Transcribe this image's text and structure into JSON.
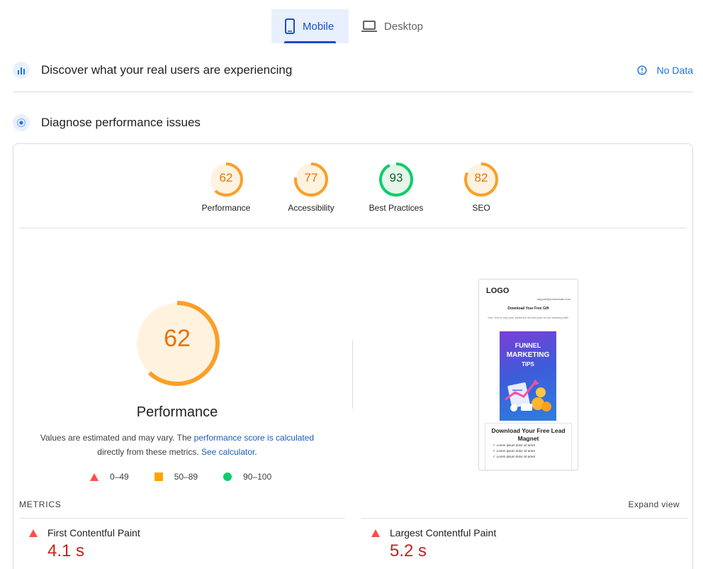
{
  "tabs": [
    {
      "label": "Mobile",
      "active": true,
      "icon": "smartphone-icon"
    },
    {
      "label": "Desktop",
      "active": false,
      "icon": "laptop-icon"
    }
  ],
  "real_users": {
    "title": "Discover what your real users are experiencing",
    "status": "No Data",
    "icon": "users-chart-icon",
    "status_icon": "info-icon"
  },
  "diagnose": {
    "title": "Diagnose performance issues",
    "icon": "diagnose-target-icon"
  },
  "scores": [
    {
      "label": "Performance",
      "value": "62",
      "color": "#e8710a",
      "ring": "#fa9f28",
      "fraction": 0.62
    },
    {
      "label": "Accessibility",
      "value": "77",
      "color": "#e8710a",
      "ring": "#fa9f28",
      "fraction": 0.77
    },
    {
      "label": "Best Practices",
      "value": "93",
      "color": "#0d652d",
      "ring": "#0cce6b",
      "fraction": 0.93
    },
    {
      "label": "SEO",
      "value": "82",
      "color": "#e8710a",
      "ring": "#fa9f28",
      "fraction": 0.82
    }
  ],
  "performance": {
    "score": "62",
    "fraction": 0.62,
    "title": "Performance",
    "desc_prefix": "Values are estimated and may vary. The ",
    "desc_link1": "performance score is calculated",
    "desc_middle": " directly from these metrics. ",
    "desc_link2": "See calculator",
    "desc_suffix": "."
  },
  "legend": [
    {
      "range": "0–49",
      "shape": "triangle",
      "color": "#ff4e42"
    },
    {
      "range": "50–89",
      "shape": "square",
      "color": "#ffa400"
    },
    {
      "range": "90–100",
      "shape": "circle",
      "color": "#0cce6b"
    }
  ],
  "screenshot": {
    "logo": "LOGO",
    "email": "support@yourdomain.com",
    "download_title": "Download Your Free Gift",
    "subtext": "Sub-Text of why your audience should optin to this amazing offer",
    "book_lines": [
      "FUNNEL",
      "MARKETING",
      "TIPS"
    ],
    "panel_title": "Download Your Free Lead Magnet",
    "bullets": [
      "Lorem ipsum dolor sit amet",
      "Lorem ipsum dolor sit amet",
      "Lorem ipsum dolor sit amet"
    ]
  },
  "metrics": {
    "label": "METRICS",
    "expand": "Expand view",
    "items": [
      {
        "name": "First Contentful Paint",
        "value": "4.1 s",
        "status": "fail"
      },
      {
        "name": "Largest Contentful Paint",
        "value": "5.2 s",
        "status": "fail"
      }
    ]
  }
}
